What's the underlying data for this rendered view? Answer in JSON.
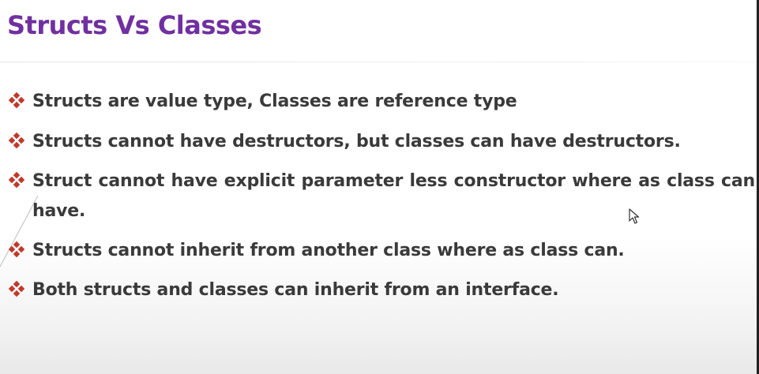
{
  "slide": {
    "title": "Structs Vs Classes",
    "bullets": [
      {
        "text": "Structs are value type, Classes are reference type"
      },
      {
        "text": "Structs cannot have destructors, but classes can have destructors."
      },
      {
        "text": "Struct cannot have explicit parameter less constructor where as class can have."
      },
      {
        "text": "Structs cannot inherit from another class where as class can."
      },
      {
        "text": "Both structs and classes can inherit from an interface."
      }
    ],
    "bullet_icon": "diamond-bullet-icon",
    "colors": {
      "title": "#7030a0",
      "bullet": "#c0392b",
      "text": "#3a3a3a"
    }
  }
}
